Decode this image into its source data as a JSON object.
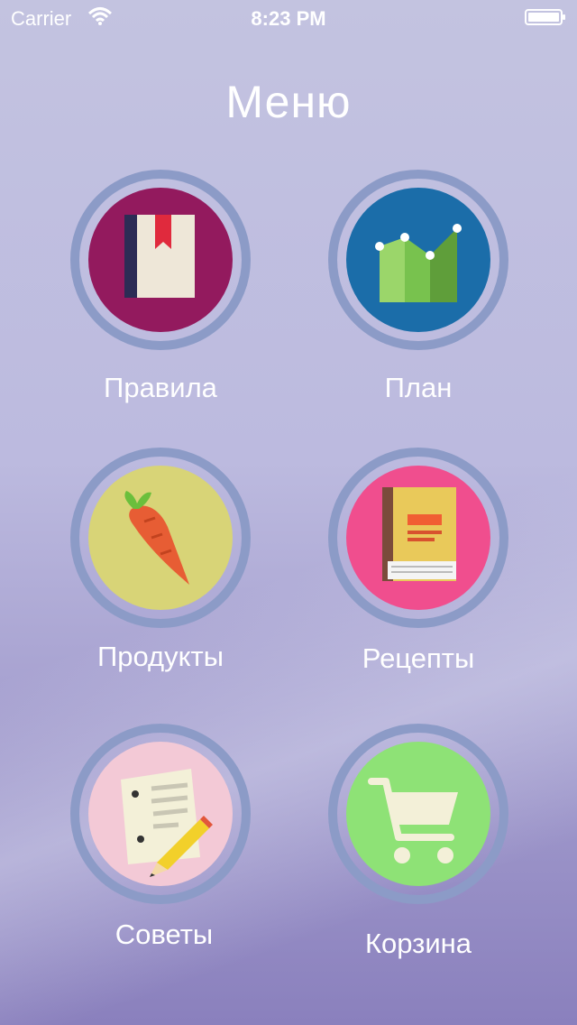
{
  "status_bar": {
    "carrier": "Carrier",
    "time": "8:23 PM"
  },
  "title": "Меню",
  "menu": {
    "items": [
      {
        "label": "Правила",
        "icon": "rules-book-icon",
        "color": "#931a5e"
      },
      {
        "label": "План",
        "icon": "plan-chart-icon",
        "color": "#1b6da9"
      },
      {
        "label": "Продукты",
        "icon": "carrot-icon",
        "color": "#d8d477"
      },
      {
        "label": "Рецепты",
        "icon": "recipe-book-icon",
        "color": "#f04e8e"
      },
      {
        "label": "Советы",
        "icon": "notes-pencil-icon",
        "color": "#f3c9d6"
      },
      {
        "label": "Корзина",
        "icon": "shopping-cart-icon",
        "color": "#8ee276"
      }
    ]
  }
}
